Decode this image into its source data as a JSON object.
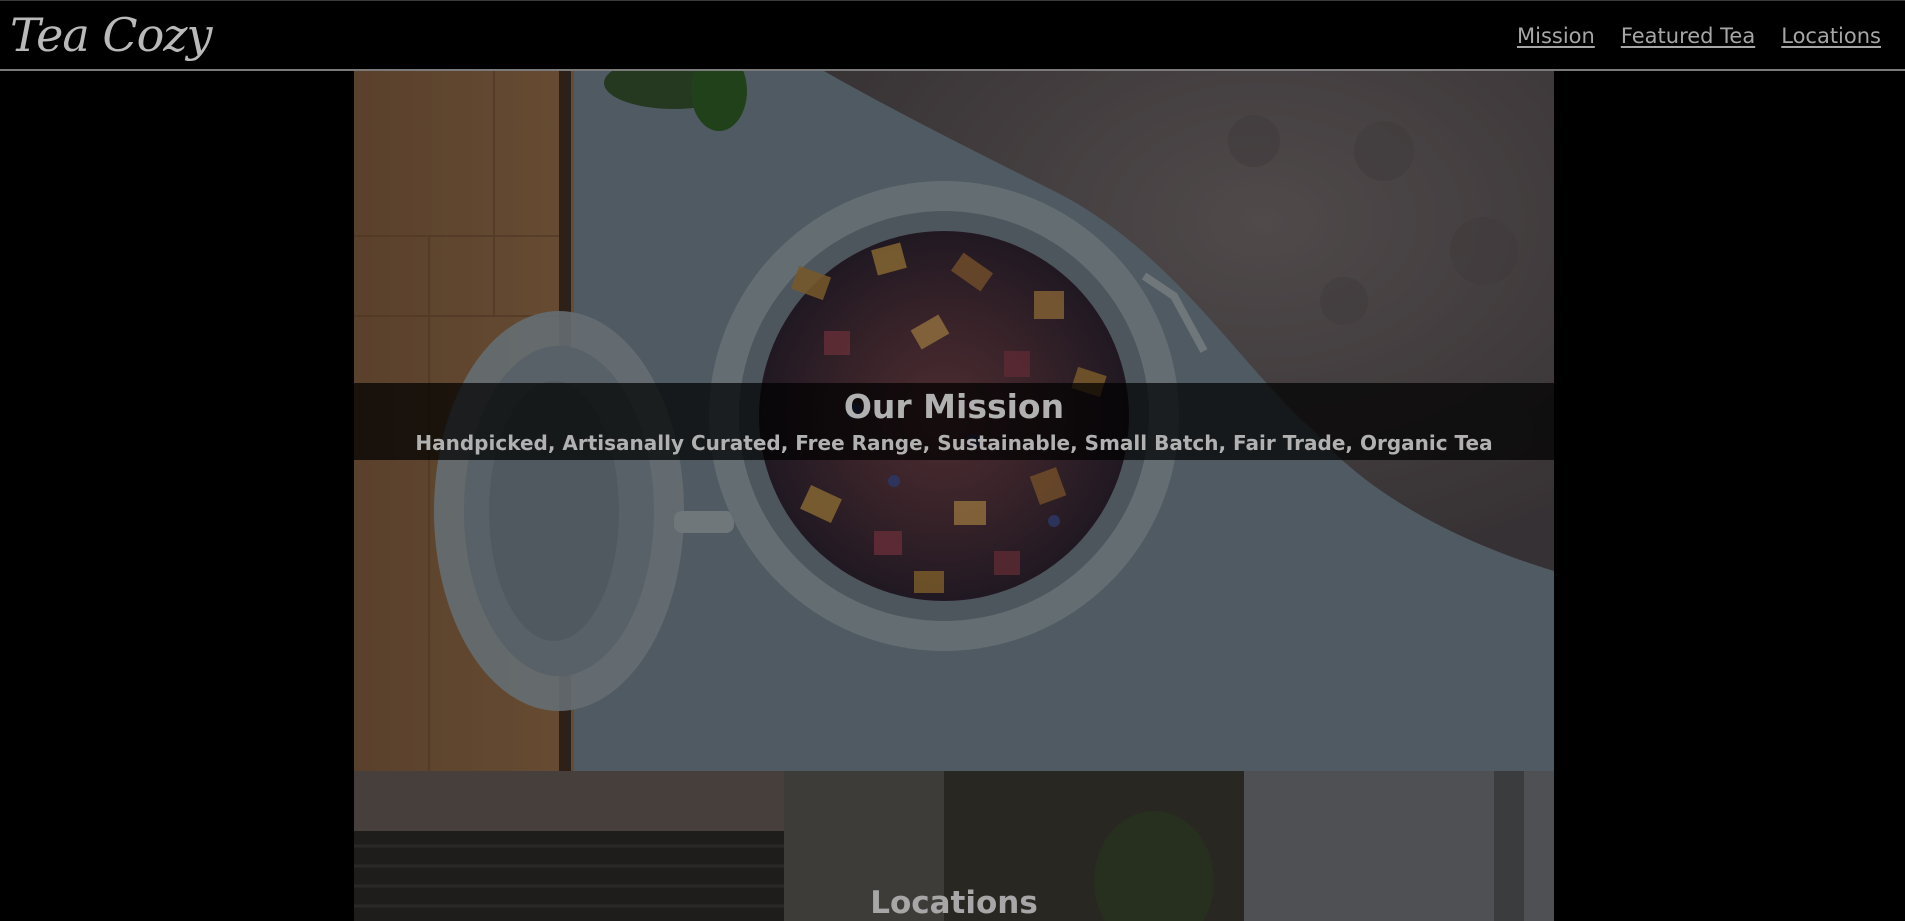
{
  "header": {
    "logo_text": "Tea Cozy",
    "nav": [
      {
        "label": "Mission"
      },
      {
        "label": "Featured Tea"
      },
      {
        "label": "Locations"
      }
    ]
  },
  "mission": {
    "title": "Our Mission",
    "subtitle": "Handpicked, Artisanally Curated, Free Range, Sustainable, Small Batch, Fair Trade, Organic Tea",
    "image_icon": "tea-jar-photo"
  },
  "locations": {
    "title": "Locations",
    "image_icon": "storefront-photo"
  },
  "colors": {
    "page_background": "#000000",
    "text_muted": "#b1b1b1",
    "band_overlay": "rgba(0,0,0,0.72)"
  }
}
